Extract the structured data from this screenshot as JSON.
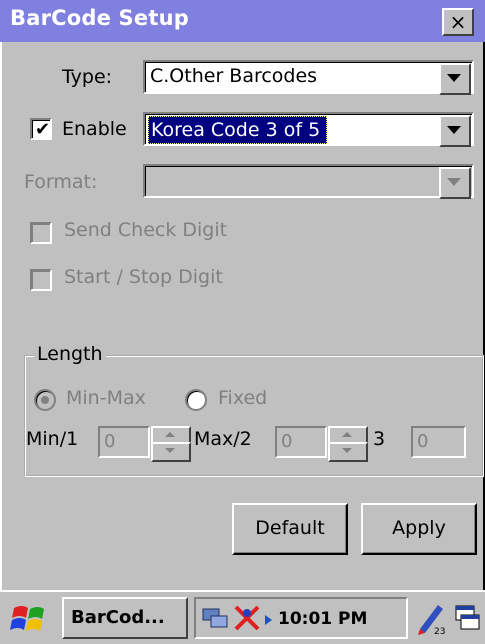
{
  "window": {
    "title": "BarCode Setup",
    "close_label": "×"
  },
  "form": {
    "type_label": "Type:",
    "type_value": "C.Other Barcodes",
    "enable_label": "Enable",
    "enable_checked": "✔",
    "enable_value": "Korea Code 3 of 5",
    "format_label": "Format:",
    "format_value": "",
    "send_check_digit_label": "Send Check Digit",
    "start_stop_digit_label": "Start / Stop Digit"
  },
  "length": {
    "group_label": "Length",
    "minmax_label": "Min-Max",
    "fixed_label": "Fixed",
    "min_label": "Min/1",
    "min_value": "0",
    "max_label": "Max/2",
    "max_value": "0",
    "third_label": "3",
    "third_value": "0"
  },
  "buttons": {
    "default_label": "Default",
    "apply_label": "Apply"
  },
  "taskbar": {
    "app_button_label": "BarCod...",
    "clock": "10:01 PM"
  }
}
